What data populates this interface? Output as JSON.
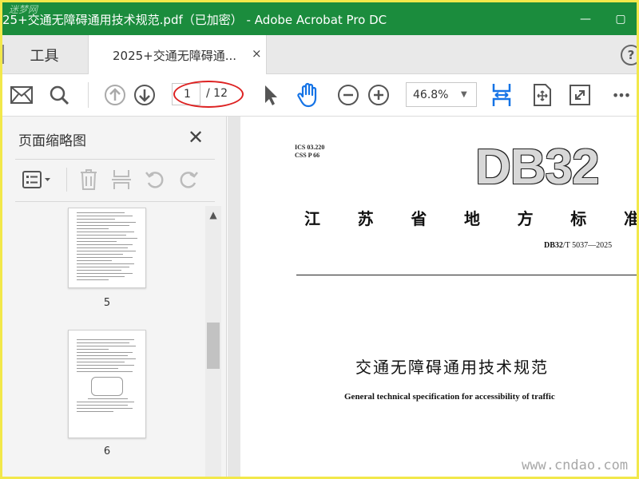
{
  "window": {
    "title": "25+交通无障碍通用技术规范.pdf（已加密） - Adobe Acrobat Pro DC",
    "watermark": "迷梦网",
    "minimize_glyph": "—",
    "restore_glyph": "▢"
  },
  "tabs": {
    "tools_label": "工具",
    "doc_label": "2025+交通无障碍通...",
    "close_glyph": "×",
    "help_glyph": "?"
  },
  "toolbar": {
    "current_page": "1",
    "total_pages": "/ 12",
    "zoom": "46.8%",
    "zoom_caret": "▼",
    "more_glyph": "•••",
    "accent_color": "#1473e6",
    "highlight_color": "#d22222"
  },
  "sidepanel": {
    "title": "页面缩略图",
    "close_glyph": "✕",
    "thumbnails": [
      {
        "page_label": "5"
      },
      {
        "page_label": "6"
      }
    ],
    "scroll_up_glyph": "▲",
    "collapse_glyph": "◀"
  },
  "document": {
    "ics_line": "ICS  03.220",
    "css_line": "CSS  P  66",
    "logo": "DB32",
    "standard_type_chars": [
      "江",
      "苏",
      "省",
      "地",
      "方",
      "标",
      "准"
    ],
    "code_prefix": "DB32",
    "code_suffix": "/T 5037—2025",
    "title_cn": "交通无障碍通用技术规范",
    "title_en": "General technical specification for accessibility of traffic"
  },
  "watermark_bottom": "www.cndao.com"
}
